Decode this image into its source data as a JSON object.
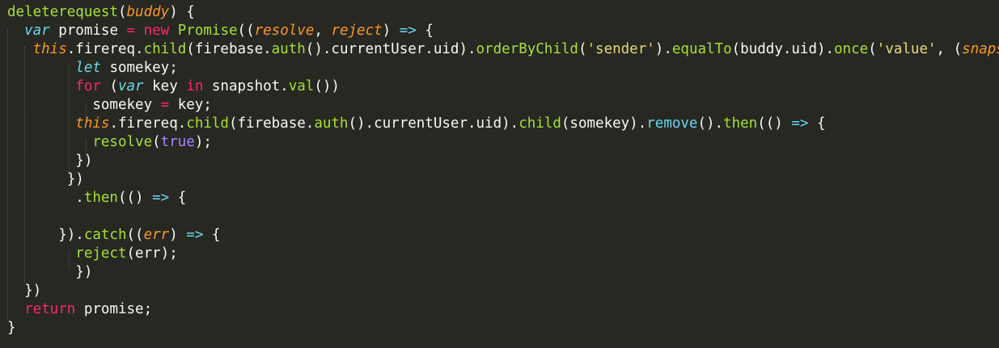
{
  "editor": {
    "colors": {
      "background": "#272822",
      "plain": "#f8f8f2",
      "function": "#a6e22e",
      "keyword": "#f92672",
      "storage": "#66d9ef",
      "parameter": "#fd971f",
      "string": "#e6db74",
      "constant": "#ae81ff"
    },
    "lines": [
      {
        "tokens": [
          {
            "t": "deleterequest",
            "k": "fn"
          },
          {
            "t": "(",
            "k": "pl"
          },
          {
            "t": "buddy",
            "k": "pa"
          },
          {
            "t": ") {",
            "k": "pl"
          }
        ]
      },
      {
        "tokens": [
          {
            "t": "  ",
            "k": "pl"
          },
          {
            "t": "var",
            "k": "st"
          },
          {
            "t": " promise ",
            "k": "pl"
          },
          {
            "t": "=",
            "k": "kw"
          },
          {
            "t": " ",
            "k": "pl"
          },
          {
            "t": "new",
            "k": "kw"
          },
          {
            "t": " ",
            "k": "pl"
          },
          {
            "t": "Promise",
            "k": "cls"
          },
          {
            "t": "((",
            "k": "pl"
          },
          {
            "t": "resolve",
            "k": "pa"
          },
          {
            "t": ", ",
            "k": "pl"
          },
          {
            "t": "reject",
            "k": "pa"
          },
          {
            "t": ") ",
            "k": "pl"
          },
          {
            "t": "=>",
            "k": "st"
          },
          {
            "t": " {",
            "k": "pl"
          }
        ]
      },
      {
        "tokens": [
          {
            "t": "   ",
            "k": "pl"
          },
          {
            "t": "this",
            "k": "pa"
          },
          {
            "t": ".firereq.",
            "k": "pl"
          },
          {
            "t": "child",
            "k": "fn"
          },
          {
            "t": "(firebase.",
            "k": "pl"
          },
          {
            "t": "auth",
            "k": "fn"
          },
          {
            "t": "().currentUser.uid).",
            "k": "pl"
          },
          {
            "t": "orderByChild",
            "k": "fn"
          },
          {
            "t": "(",
            "k": "pl"
          },
          {
            "t": "'sender'",
            "k": "str"
          },
          {
            "t": ").",
            "k": "pl"
          },
          {
            "t": "equalTo",
            "k": "fn"
          },
          {
            "t": "(buddy.uid).",
            "k": "pl"
          },
          {
            "t": "once",
            "k": "fn"
          },
          {
            "t": "(",
            "k": "pl"
          },
          {
            "t": "'value'",
            "k": "str"
          },
          {
            "t": ", (",
            "k": "pl"
          },
          {
            "t": "snapshot",
            "k": "pa"
          }
        ]
      },
      {
        "tokens": [
          {
            "t": "        ",
            "k": "pl"
          },
          {
            "t": "let",
            "k": "st"
          },
          {
            "t": " somekey;",
            "k": "pl"
          }
        ]
      },
      {
        "tokens": [
          {
            "t": "        ",
            "k": "pl"
          },
          {
            "t": "for",
            "k": "kw"
          },
          {
            "t": " (",
            "k": "pl"
          },
          {
            "t": "var",
            "k": "st"
          },
          {
            "t": " key ",
            "k": "pl"
          },
          {
            "t": "in",
            "k": "kw"
          },
          {
            "t": " snapshot.",
            "k": "pl"
          },
          {
            "t": "val",
            "k": "fn"
          },
          {
            "t": "())",
            "k": "pl"
          }
        ]
      },
      {
        "tokens": [
          {
            "t": "          somekey ",
            "k": "pl"
          },
          {
            "t": "=",
            "k": "kw"
          },
          {
            "t": " key;",
            "k": "pl"
          }
        ]
      },
      {
        "tokens": [
          {
            "t": "        ",
            "k": "pl"
          },
          {
            "t": "this",
            "k": "pa"
          },
          {
            "t": ".firereq.",
            "k": "pl"
          },
          {
            "t": "child",
            "k": "fn"
          },
          {
            "t": "(firebase.",
            "k": "pl"
          },
          {
            "t": "auth",
            "k": "fn"
          },
          {
            "t": "().currentUser.uid).",
            "k": "pl"
          },
          {
            "t": "child",
            "k": "fn"
          },
          {
            "t": "(somekey).",
            "k": "pl"
          },
          {
            "t": "remove",
            "k": "call"
          },
          {
            "t": "().",
            "k": "pl"
          },
          {
            "t": "then",
            "k": "fn"
          },
          {
            "t": "(() ",
            "k": "pl"
          },
          {
            "t": "=>",
            "k": "st"
          },
          {
            "t": " {",
            "k": "pl"
          }
        ]
      },
      {
        "tokens": [
          {
            "t": "          ",
            "k": "pl"
          },
          {
            "t": "resolve",
            "k": "fn"
          },
          {
            "t": "(",
            "k": "pl"
          },
          {
            "t": "true",
            "k": "co"
          },
          {
            "t": ");",
            "k": "pl"
          }
        ]
      },
      {
        "tokens": [
          {
            "t": "        })",
            "k": "pl"
          }
        ]
      },
      {
        "tokens": [
          {
            "t": "       })",
            "k": "pl"
          }
        ]
      },
      {
        "tokens": [
          {
            "t": "        .",
            "k": "pl"
          },
          {
            "t": "then",
            "k": "fn"
          },
          {
            "t": "(() ",
            "k": "pl"
          },
          {
            "t": "=>",
            "k": "st"
          },
          {
            "t": " {",
            "k": "pl"
          }
        ]
      },
      {
        "tokens": [
          {
            "t": "",
            "k": "pl"
          }
        ]
      },
      {
        "tokens": [
          {
            "t": "      }).",
            "k": "pl"
          },
          {
            "t": "catch",
            "k": "fn"
          },
          {
            "t": "((",
            "k": "pl"
          },
          {
            "t": "err",
            "k": "pa"
          },
          {
            "t": ") ",
            "k": "pl"
          },
          {
            "t": "=>",
            "k": "st"
          },
          {
            "t": " {",
            "k": "pl"
          }
        ]
      },
      {
        "tokens": [
          {
            "t": "        ",
            "k": "pl"
          },
          {
            "t": "reject",
            "k": "fn"
          },
          {
            "t": "(err);",
            "k": "pl"
          }
        ]
      },
      {
        "tokens": [
          {
            "t": "        })",
            "k": "pl"
          }
        ]
      },
      {
        "tokens": [
          {
            "t": "  })",
            "k": "pl"
          }
        ]
      },
      {
        "tokens": [
          {
            "t": "  ",
            "k": "pl"
          },
          {
            "t": "return",
            "k": "kw"
          },
          {
            "t": " promise;",
            "k": "pl"
          }
        ]
      },
      {
        "tokens": [
          {
            "t": "}",
            "k": "pl"
          }
        ]
      }
    ]
  }
}
